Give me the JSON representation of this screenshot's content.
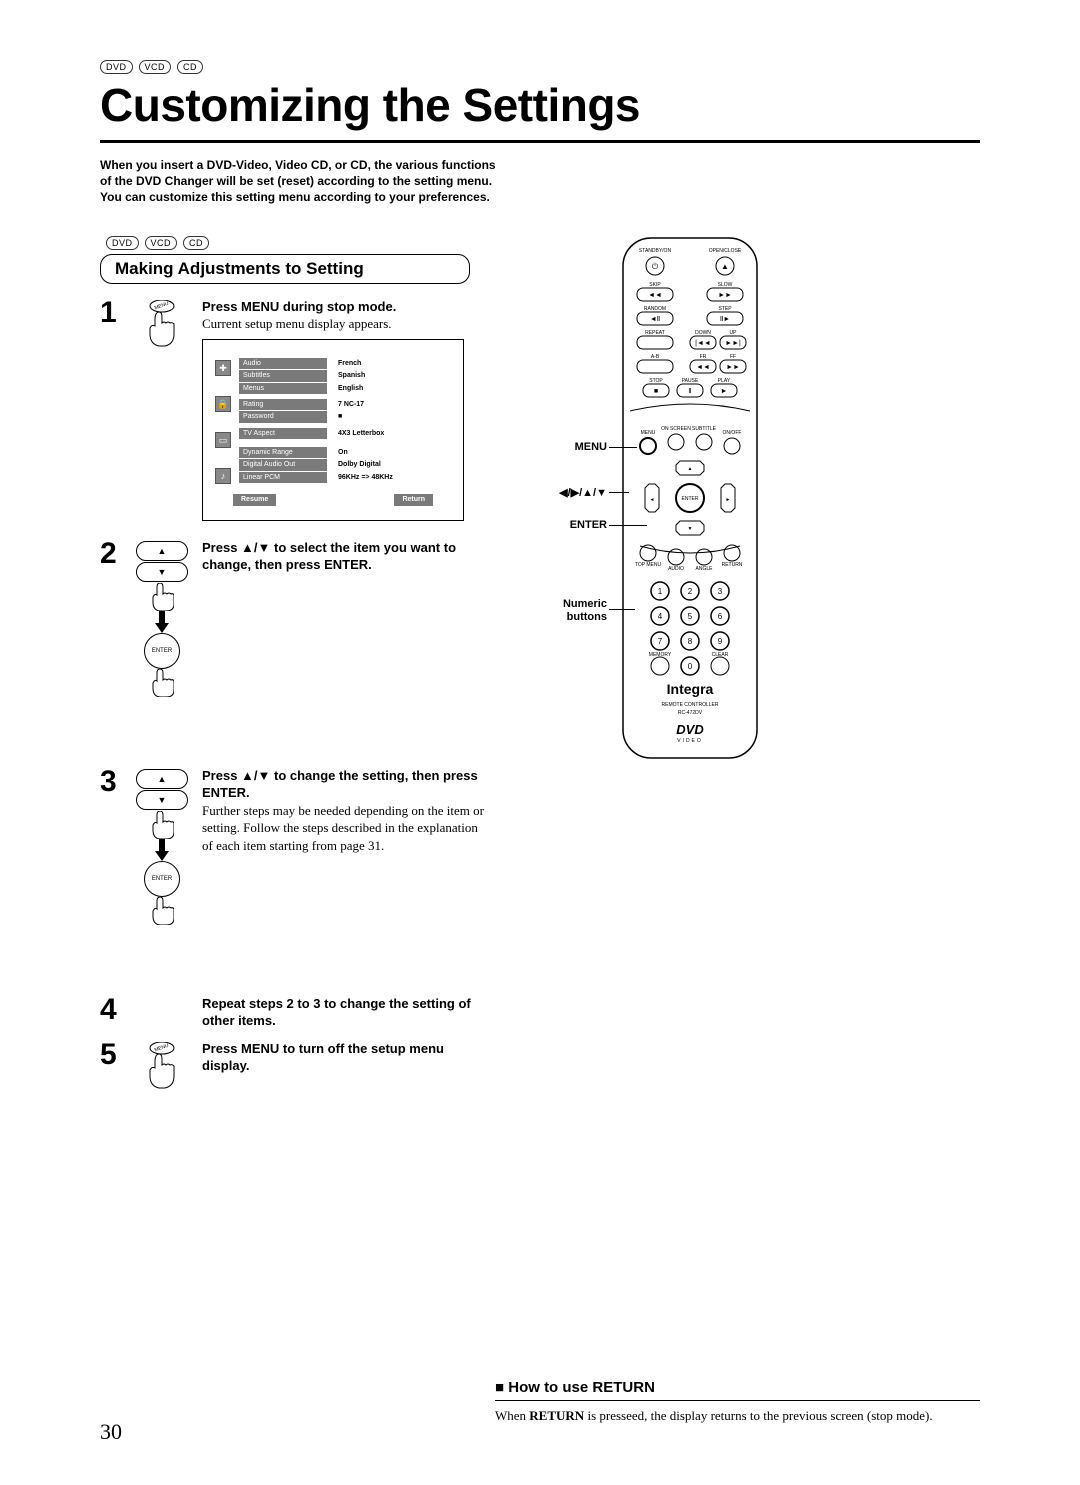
{
  "disc_tags": {
    "dvd": "DVD",
    "vcd": "VCD",
    "cd": "CD"
  },
  "title": "Customizing the Settings",
  "intro": "When you insert a DVD-Video, Video CD, or CD, the various functions of the DVD Changer will be set (reset) according to the setting menu.\nYou can customize this setting menu according to your preferences.",
  "section_heading": "Making Adjustments to Setting",
  "steps": [
    {
      "num": "1",
      "bold": "Press MENU during stop mode.",
      "plain": "Current setup menu display appears."
    },
    {
      "num": "2",
      "bold": "Press ▲/▼ to select the item you want to change, then press ENTER.",
      "plain": ""
    },
    {
      "num": "3",
      "bold": "Press ▲/▼ to change the setting, then press ENTER.",
      "plain": "Further steps may be needed depending on the item or setting. Follow the steps described in the explanation of each item starting from page 31."
    },
    {
      "num": "4",
      "bold": "Repeat steps 2 to 3 to change the setting of other items.",
      "plain": ""
    },
    {
      "num": "5",
      "bold": "Press MENU to turn off the setup menu display.",
      "plain": ""
    }
  ],
  "menu_btn_text": "MENU",
  "enter_btn_text": "ENTER",
  "setup_menu": {
    "lang_items": [
      "Audio",
      "Subtitles",
      "Menus"
    ],
    "lang_vals": [
      "French",
      "Spanish",
      "English"
    ],
    "rating_items": [
      "Rating",
      "Password"
    ],
    "rating_vals": [
      "7 NC-17",
      "■"
    ],
    "tv_items": [
      "TV Aspect"
    ],
    "tv_vals": [
      "4X3 Letterbox"
    ],
    "audio_items": [
      "Dynamic Range",
      "Digital Audio Out",
      "Linear PCM"
    ],
    "audio_vals": [
      "On",
      "Dolby Digital",
      "96KHz => 48KHz"
    ],
    "resume": "Resume",
    "ret": "Return"
  },
  "remote_labels": {
    "menu": "MENU",
    "arrows": "◀/▶/▲/▼",
    "enter": "ENTER",
    "numeric": "Numeric buttons",
    "brand": "Integra",
    "sub": "REMOTE CONTROLLER",
    "model": "RC-472DV",
    "dvd": "DVD",
    "dvdsub": "VIDEO",
    "btn_labels": {
      "standby": "STANDBY/ON",
      "open": "OPEN/CLOSE",
      "skip": "SKIP",
      "slow": "SLOW",
      "random": "RANDOM",
      "step": "STEP",
      "repeat": "REPEAT",
      "down": "DOWN",
      "up": "UP",
      "ab": "A-B",
      "fr": "FR",
      "ff": "FF",
      "stop": "STOP",
      "pause": "PAUSE",
      "play": "PLAY",
      "menub": "MENU",
      "onscreen": "ON SCREEN",
      "subtitle": "SUBTITLE",
      "onoff": "ON/OFF",
      "entercenter": "ENTER",
      "topmenu": "TOP MENU",
      "audio": "AUDIO",
      "angle": "ANGLE",
      "retu": "RETURN",
      "memory": "MEMORY",
      "clear": "CLEAR"
    }
  },
  "howto": {
    "title_prefix": "■ ",
    "title": "How to use RETURN",
    "body_pre": "When ",
    "body_bold": "RETURN",
    "body_post": " is presseed, the display returns to the previous screen (stop mode)."
  },
  "page_number": "30"
}
